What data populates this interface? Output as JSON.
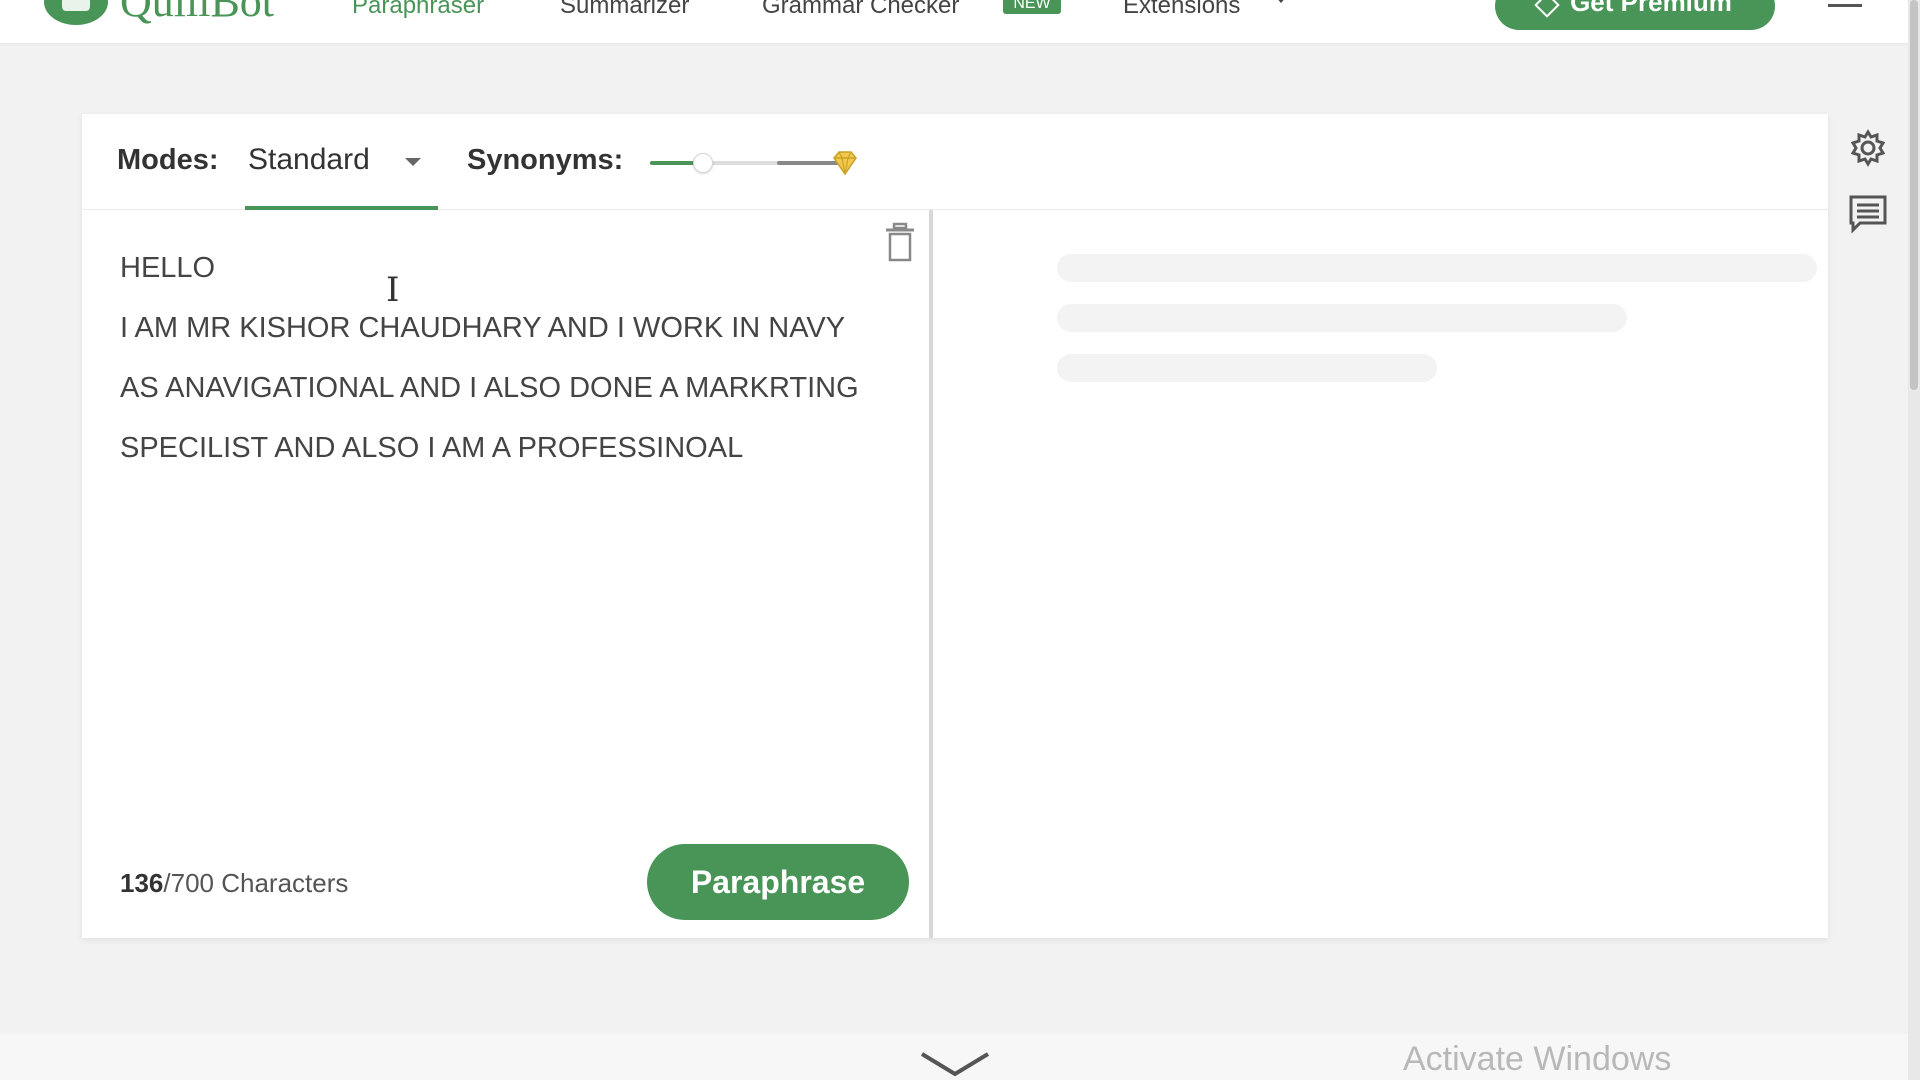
{
  "brand": {
    "name": "QuillBot",
    "color": "#499557"
  },
  "nav": {
    "items": [
      {
        "label": "Paraphraser",
        "active": true
      },
      {
        "label": "Summarizer",
        "active": false
      },
      {
        "label": "Grammar Checker",
        "active": false
      },
      {
        "label": "Extensions",
        "active": false
      }
    ],
    "grammar_badge": "NEW",
    "premium_label": "Get Premium"
  },
  "toolbar": {
    "modes_label": "Modes:",
    "mode_value": "Standard",
    "synonyms_label": "Synonyms:",
    "synonyms_level": 0.28
  },
  "input": {
    "lines": [
      "HELLO",
      "I AM MR KISHOR CHAUDHARY AND I WORK IN NAVY",
      "AS ANAVIGATIONAL AND I ALSO DONE A MARKRTING",
      "SPECILIST AND ALSO I AM A PROFESSINOAL"
    ],
    "char_count": "136",
    "char_limit": "/700 Characters",
    "paraphrase_label": "Paraphrase"
  },
  "system": {
    "watermark": "Activate Windows"
  },
  "icons": {
    "settings": "gear-icon",
    "feedback": "comment-icon",
    "trash": "trash-icon",
    "premium": "diamond-icon",
    "scroll": "chevron-down-icon"
  }
}
